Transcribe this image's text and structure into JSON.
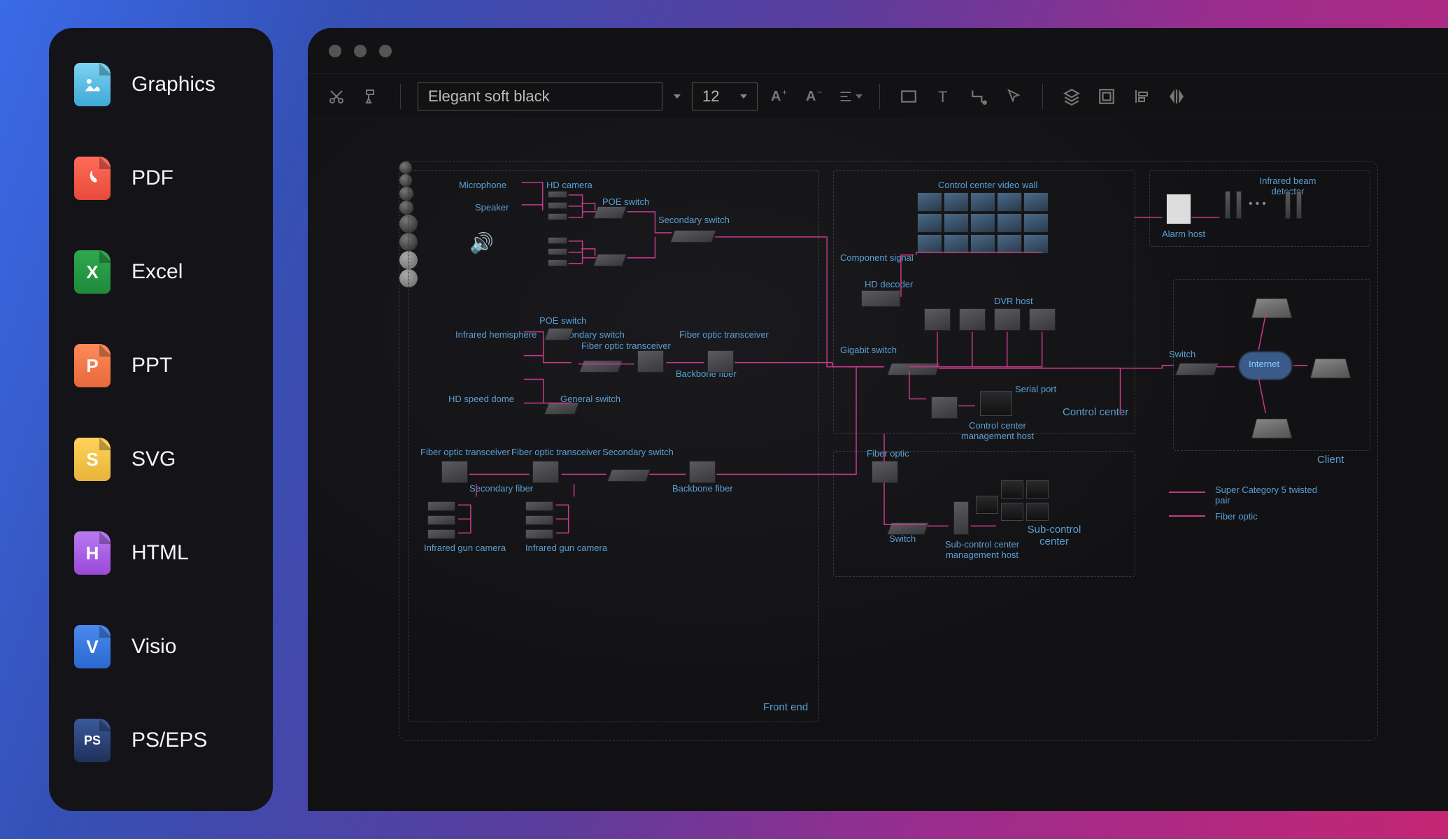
{
  "sidebar": {
    "items": [
      {
        "label": "Graphics",
        "glyph": "img"
      },
      {
        "label": "PDF",
        "glyph": "A"
      },
      {
        "label": "Excel",
        "glyph": "X"
      },
      {
        "label": "PPT",
        "glyph": "P"
      },
      {
        "label": "SVG",
        "glyph": "S"
      },
      {
        "label": "HTML",
        "glyph": "H"
      },
      {
        "label": "Visio",
        "glyph": "V"
      },
      {
        "label": "PS/EPS",
        "glyph": "PS"
      }
    ]
  },
  "toolbar": {
    "font_name": "Elegant soft black",
    "font_size": "12"
  },
  "diagram": {
    "groups": {
      "front_end": "Front end",
      "control_center": "Control center",
      "sub_control_center": "Sub-control center",
      "client": "Client"
    },
    "labels": {
      "microphone": "Microphone",
      "speaker": "Speaker",
      "hd_camera": "HD camera",
      "poe_switch": "POE switch",
      "secondary_switch": "Secondary switch",
      "infrared_hemisphere": "Infrared hemisphere",
      "hd_speed_dome": "HD speed dome",
      "fiber_optic_transceiver": "Fiber optic transceiver",
      "general_switch": "General switch",
      "backbone_fiber": "Backbone fiber",
      "infrared_gun_camera": "Infrared gun camera",
      "secondary_fiber": "Secondary fiber",
      "control_center_video_wall": "Control center video wall",
      "component_signal": "Component signal",
      "hd_decoder": "HD decoder",
      "dvr_host": "DVR host",
      "gigabit_switch": "Gigabit switch",
      "serial_port": "Serial port",
      "control_center_mgmt_host": "Control center management host",
      "fiber_optic": "Fiber optic",
      "switch": "Switch",
      "sub_control_mgmt_host": "Sub-control center management host",
      "infrared_beam_detector": "Infrared beam detector",
      "alarm_host": "Alarm host",
      "internet": "Internet"
    },
    "legend": {
      "cat5": "Super Category 5 twisted pair",
      "fiber": "Fiber optic"
    }
  }
}
